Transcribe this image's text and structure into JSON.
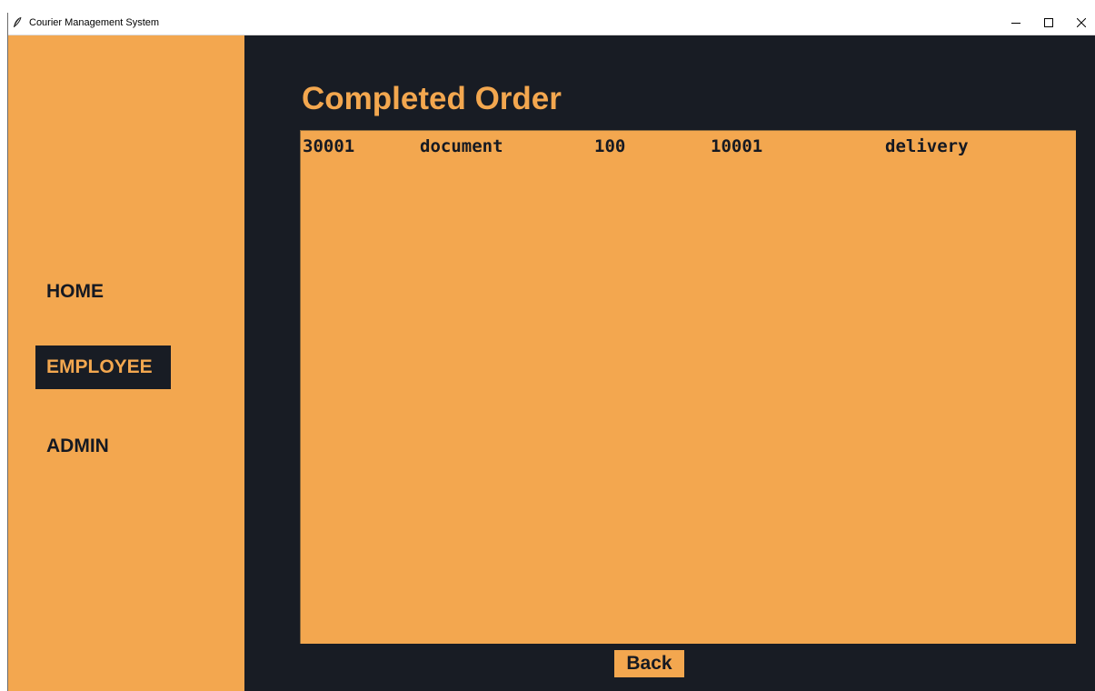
{
  "window": {
    "title": "Courier Management System"
  },
  "sidebar": {
    "items": [
      {
        "label": "HOME",
        "active": false
      },
      {
        "label": "EMPLOYEE",
        "active": true
      },
      {
        "label": "ADMIN",
        "active": false
      }
    ]
  },
  "main": {
    "title": "Completed Order",
    "orders": [
      [
        "30001",
        "document",
        "100",
        "10001",
        "delivery"
      ]
    ],
    "back_label": "Back"
  },
  "colors": {
    "accent": "#f3a74f",
    "dark": "#181c24"
  },
  "icons": {
    "app": "feather-icon",
    "minimize": "minimize-icon",
    "maximize": "maximize-icon",
    "close": "close-icon"
  }
}
